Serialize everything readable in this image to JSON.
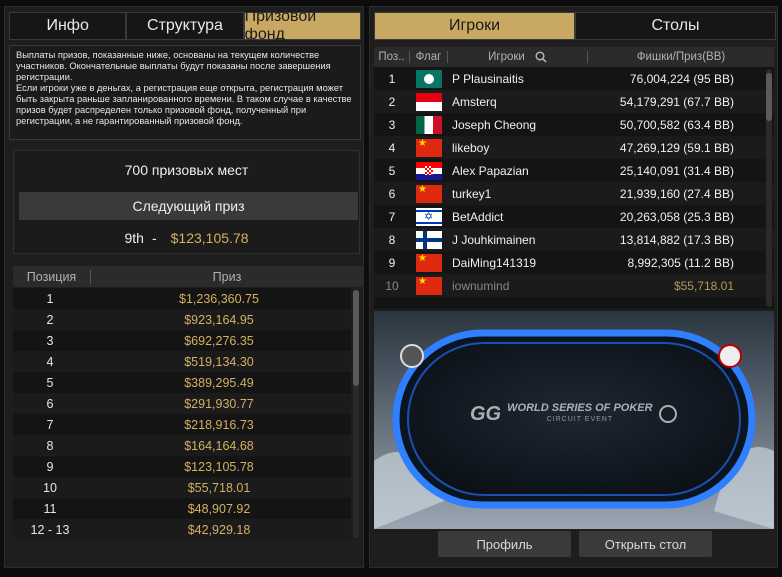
{
  "left_tabs": [
    "Инфо",
    "Структура",
    "Призовой фонд"
  ],
  "notice": [
    "Выплаты призов, показанные ниже, основаны на текущем количестве участников. Окончательные выплаты будут показаны после завершения регистрации.",
    "Если игроки уже в деньгах, а регистрация еще открыта, регистрация может быть закрыта раньше запланированного времени. В таком случае в качестве призов будет распределен только призовой фонд, полученный при регистрации, а не гарантированный призовой фонд."
  ],
  "prize_summary": {
    "places": "700 призовых мест",
    "next_prize_label": "Следующий приз",
    "next_place": "9th",
    "separator": "-",
    "next_amount": "$123,105.78"
  },
  "prize_table": {
    "headers": [
      "Позиция",
      "Приз"
    ],
    "rows": [
      [
        "1",
        "$1,236,360.75"
      ],
      [
        "2",
        "$923,164.95"
      ],
      [
        "3",
        "$692,276.35"
      ],
      [
        "4",
        "$519,134.30"
      ],
      [
        "5",
        "$389,295.49"
      ],
      [
        "6",
        "$291,930.77"
      ],
      [
        "7",
        "$218,916.73"
      ],
      [
        "8",
        "$164,164.68"
      ],
      [
        "9",
        "$123,105.78"
      ],
      [
        "10",
        "$55,718.01"
      ],
      [
        "11",
        "$48,907.92"
      ],
      [
        "12 - 13",
        "$42,929.18"
      ]
    ]
  },
  "right_tabs": [
    "Игроки",
    "Столы"
  ],
  "players_table": {
    "headers": [
      "Поз..",
      "Флаг",
      "Игроки",
      "Фишки/Приз(BB)"
    ],
    "rows": [
      {
        "pos": "1",
        "flag": "macau-flag",
        "name": "P Plausinaitis",
        "chips": "76,004,224 (95 BB)"
      },
      {
        "pos": "2",
        "flag": "indonesia-flag",
        "name": "Amsterq",
        "chips": "54,179,291 (67.7 BB)"
      },
      {
        "pos": "3",
        "flag": "mexico-flag",
        "name": "Joseph Cheong",
        "chips": "50,700,582 (63.4 BB)"
      },
      {
        "pos": "4",
        "flag": "china-flag",
        "name": "likeboy",
        "chips": "47,269,129 (59.1 BB)"
      },
      {
        "pos": "5",
        "flag": "croatia-flag",
        "name": "Alex Papazian",
        "chips": "25,140,091 (31.4 BB)"
      },
      {
        "pos": "6",
        "flag": "china-flag",
        "name": "turkey1",
        "chips": "21,939,160 (27.4 BB)"
      },
      {
        "pos": "7",
        "flag": "israel-flag",
        "name": "BetAddict",
        "chips": "20,263,058 (25.3 BB)"
      },
      {
        "pos": "8",
        "flag": "finland-flag",
        "name": "J Jouhkimainen",
        "chips": "13,814,882 (17.3 BB)"
      },
      {
        "pos": "9",
        "flag": "china-flag",
        "name": "DaiMing141319",
        "chips": "8,992,305 (11.2 BB)"
      },
      {
        "pos": "10",
        "flag": "china-flag",
        "name": "iownumind",
        "chips": "$55,718.01"
      }
    ]
  },
  "table_preview": {
    "logo_brand": "GG",
    "logo_text": "WORLD SERIES OF POKER",
    "logo_sub": "CIRCUIT EVENT"
  },
  "buttons": {
    "profile": "Профиль",
    "open_table": "Открыть стол"
  },
  "colors": {
    "accent": "#c9a862",
    "gold_text": "#d4b060",
    "table_rim": "#2f7fff"
  }
}
